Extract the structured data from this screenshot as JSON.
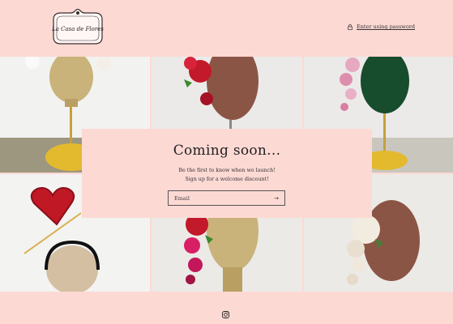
{
  "header": {
    "logo_text": "La Casa de Flores",
    "password_link": "Enter using password"
  },
  "main": {
    "heading": "Coming soon...",
    "line1": "Be the first to know when we launch!",
    "line2": "Sign up for a welcome discount!",
    "email_placeholder": "Email"
  },
  "footer": {
    "social_icon": "instagram-icon"
  },
  "colors": {
    "background": "#fdd9d4",
    "text": "#2b2b2b"
  }
}
